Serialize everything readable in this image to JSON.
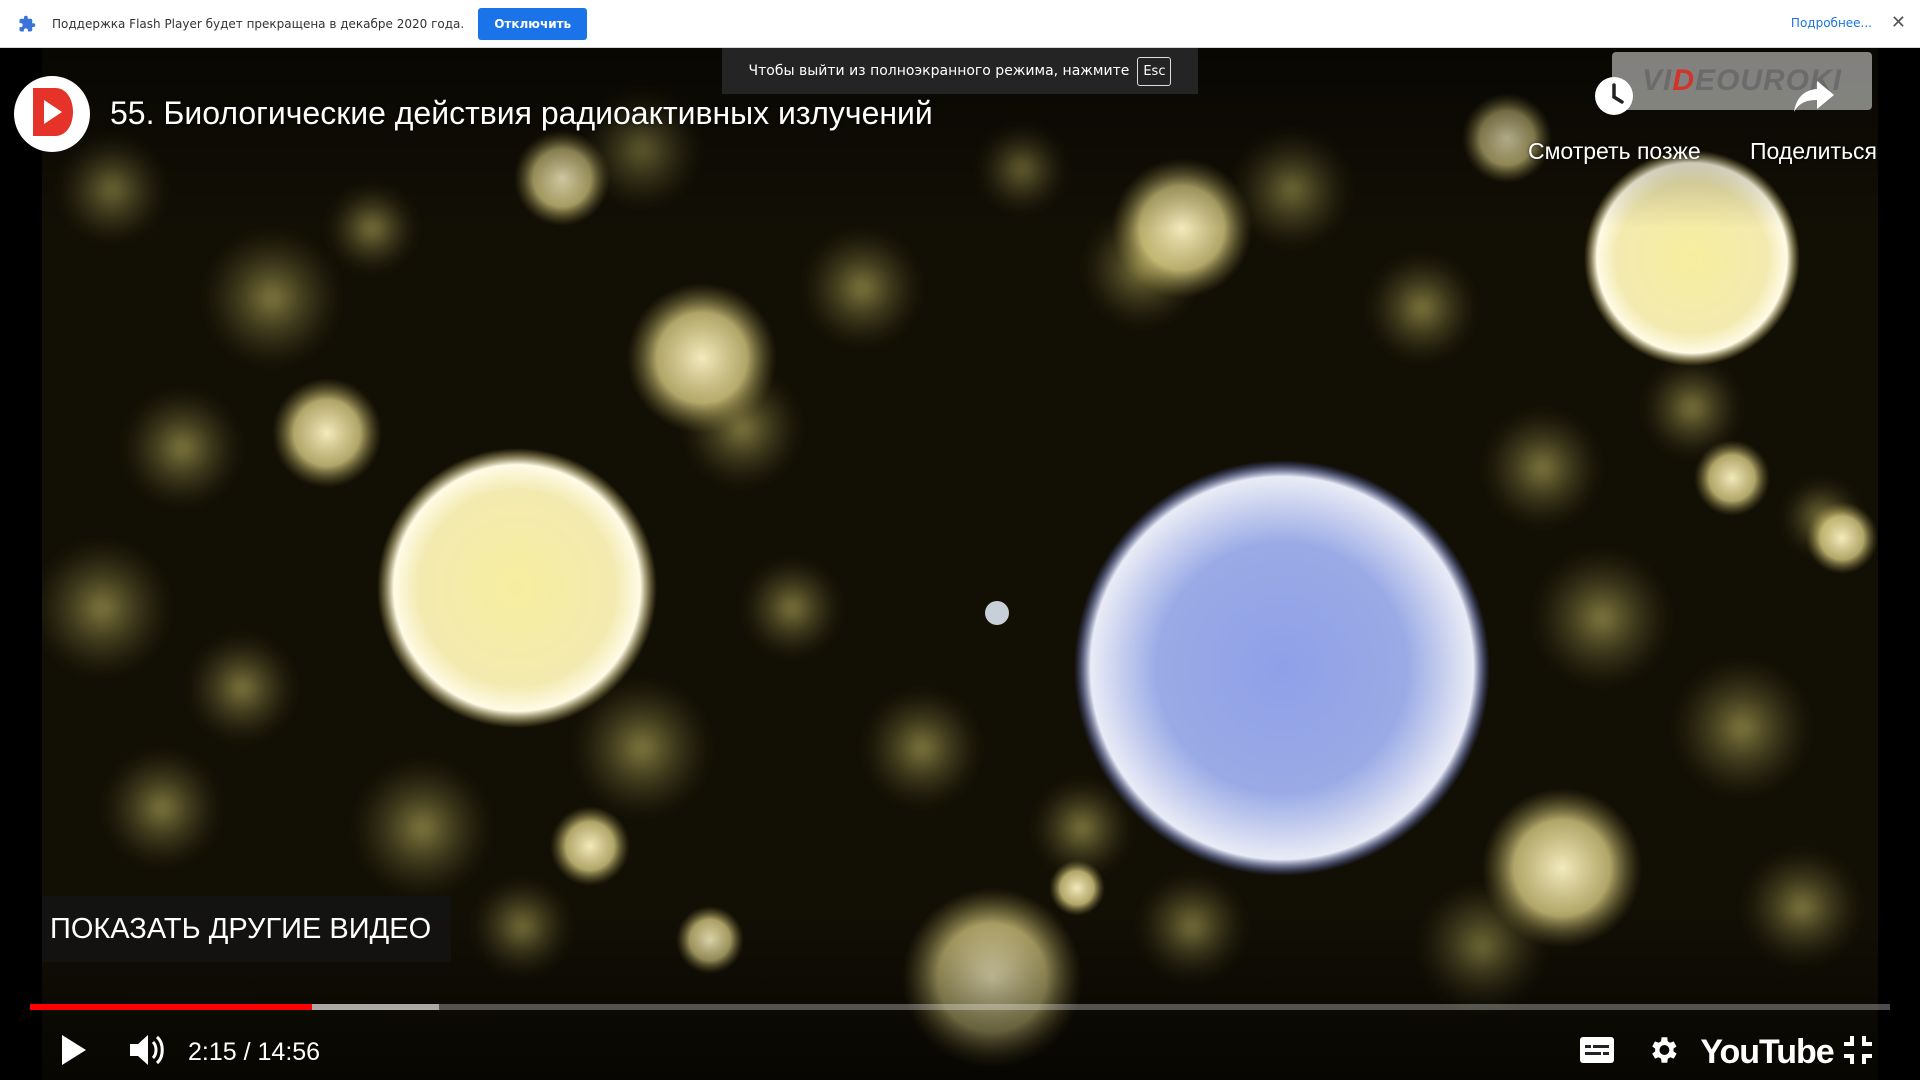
{
  "infobar": {
    "plugin_icon": "puzzle-icon",
    "message": "Поддержка Flash Player будет прекращена в декабре 2020 года.",
    "disable_label": "Отключить",
    "more_label": "Подробнее...",
    "close_icon": "close-icon"
  },
  "fullscreen_hint": {
    "text": "Чтобы выйти из полноэкранного режима, нажмите",
    "key": "Esc"
  },
  "video": {
    "title": "55. Биологические действия радиоактивных излучений",
    "watermark_a": "VI",
    "watermark_accent": "D",
    "watermark_b": "EOUROKI",
    "watch_later_label": "Смотреть позже",
    "share_label": "Поделиться",
    "more_videos_label": "ПОКАЗАТЬ ДРУГИЕ ВИДЕО"
  },
  "player": {
    "current_time": "2:15",
    "separator": " / ",
    "duration": "14:56",
    "played_fraction": 0.1516,
    "buffered_fraction": 0.22,
    "logo_text": "YouTube",
    "accent_color": "#ff0000"
  },
  "icons": {
    "play": "play-icon",
    "volume": "volume-icon",
    "captions": "captions-icon",
    "settings": "gear-icon",
    "exit_fullscreen": "exit-fullscreen-icon",
    "watch_later": "clock-icon",
    "share": "share-icon",
    "channel": "channel-logo-icon"
  }
}
